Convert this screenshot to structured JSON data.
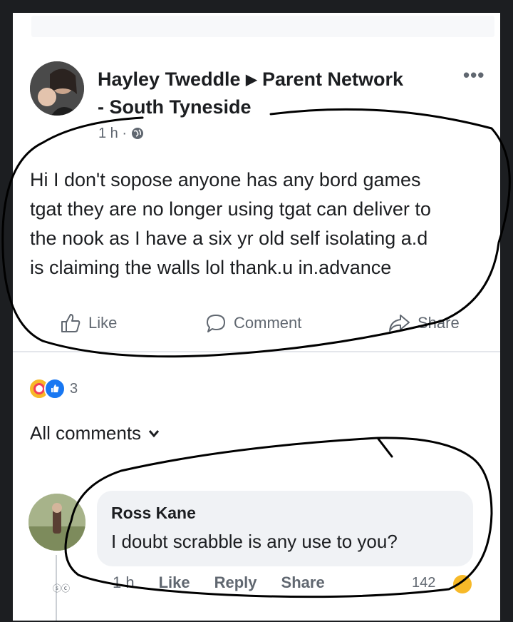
{
  "post": {
    "author": "Hayley Tweddle",
    "group": "Parent Network",
    "group_line2": "- South Tyneside",
    "timestamp": "1 h ·",
    "text_lines": [
      "Hi I don't sopose anyone has any bord games",
      "tgat they are no longer using tgat can deliver to",
      "the nook as I have a six yr old self isolating a.d",
      "is claiming the walls lol  thank.u in.advance"
    ],
    "actions": {
      "like": "Like",
      "comment": "Comment",
      "share": "Share"
    },
    "reaction_count": "3"
  },
  "comments": {
    "toggle_label": "All comments",
    "items": [
      {
        "name": "Ross Kane",
        "text": "I doubt scrabble is any use to you?",
        "time": "1 h",
        "like": "Like",
        "reply": "Reply",
        "share": "Share",
        "count": "142"
      }
    ]
  },
  "icons": [
    "ellipsis-icon",
    "globe-icon",
    "like-icon",
    "comment-icon",
    "share-icon",
    "haha-reaction-icon",
    "like-reaction-icon",
    "chevron-down-icon"
  ],
  "colors": {
    "text": "#1c1e21",
    "muted": "#606770",
    "bubble": "#f0f2f5",
    "like_blue": "#1877f2",
    "love_red": "#f33e58",
    "frame": "#1c1e21"
  }
}
